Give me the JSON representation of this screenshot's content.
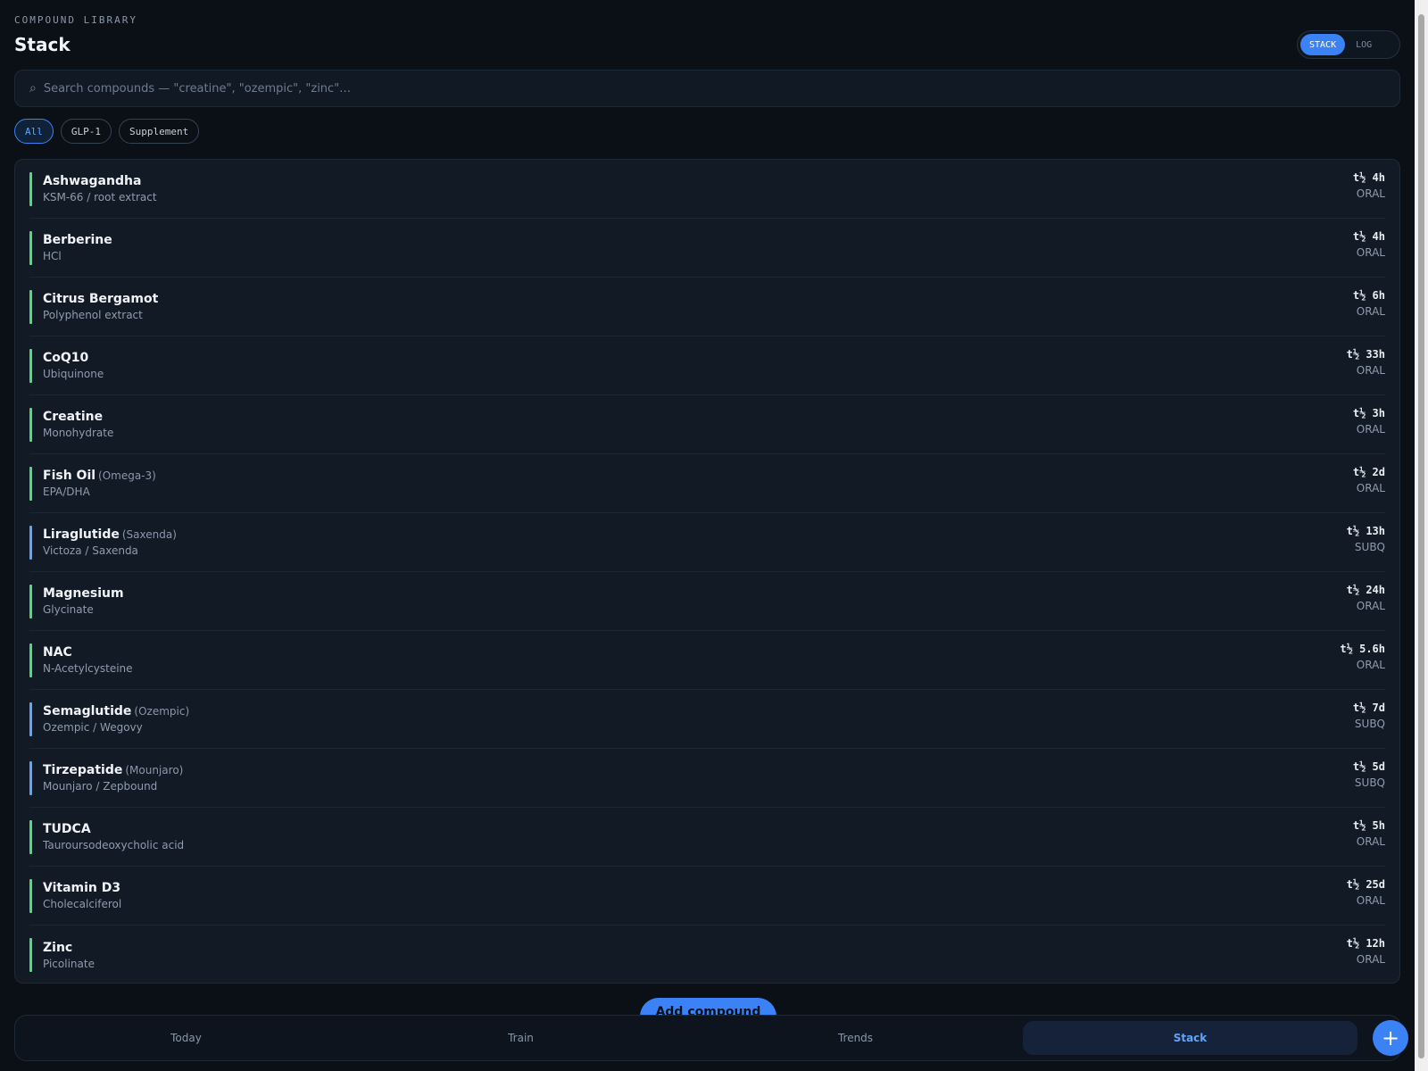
{
  "header": {
    "eyebrow": "COMPOUND LIBRARY",
    "title": "Stack"
  },
  "view_toggle": {
    "options": [
      "STACK",
      "LOG"
    ],
    "selected": "STACK"
  },
  "search": {
    "placeholder": "Search compounds — \"creatine\", \"ozempic\", \"zinc\"…",
    "value": ""
  },
  "filters": {
    "chips": [
      "All",
      "GLP-1",
      "Supplement"
    ],
    "selected": "All"
  },
  "colors": {
    "supplement": "#4ade80",
    "glp1": "#60a5fa",
    "accent": "#3b82f6"
  },
  "compounds": [
    {
      "name": "Ashwagandha",
      "alias": "",
      "sub": "KSM-66 / root extract",
      "half_life": "t½ 4h",
      "route": "ORAL",
      "category": "supplement"
    },
    {
      "name": "Berberine",
      "alias": "",
      "sub": "HCl",
      "half_life": "t½ 4h",
      "route": "ORAL",
      "category": "supplement"
    },
    {
      "name": "Citrus Bergamot",
      "alias": "",
      "sub": "Polyphenol extract",
      "half_life": "t½ 6h",
      "route": "ORAL",
      "category": "supplement"
    },
    {
      "name": "CoQ10",
      "alias": "",
      "sub": "Ubiquinone",
      "half_life": "t½ 33h",
      "route": "ORAL",
      "category": "supplement"
    },
    {
      "name": "Creatine",
      "alias": "",
      "sub": "Monohydrate",
      "half_life": "t½ 3h",
      "route": "ORAL",
      "category": "supplement"
    },
    {
      "name": "Fish Oil",
      "alias": "(Omega-3)",
      "sub": "EPA/DHA",
      "half_life": "t½ 2d",
      "route": "ORAL",
      "category": "supplement"
    },
    {
      "name": "Liraglutide",
      "alias": "(Saxenda)",
      "sub": "Victoza / Saxenda",
      "half_life": "t½ 13h",
      "route": "SUBQ",
      "category": "glp1"
    },
    {
      "name": "Magnesium",
      "alias": "",
      "sub": "Glycinate",
      "half_life": "t½ 24h",
      "route": "ORAL",
      "category": "supplement"
    },
    {
      "name": "NAC",
      "alias": "",
      "sub": "N-Acetylcysteine",
      "half_life": "t½ 5.6h",
      "route": "ORAL",
      "category": "supplement"
    },
    {
      "name": "Semaglutide",
      "alias": "(Ozempic)",
      "sub": "Ozempic / Wegovy",
      "half_life": "t½ 7d",
      "route": "SUBQ",
      "category": "glp1"
    },
    {
      "name": "Tirzepatide",
      "alias": "(Mounjaro)",
      "sub": "Mounjaro / Zepbound",
      "half_life": "t½ 5d",
      "route": "SUBQ",
      "category": "glp1"
    },
    {
      "name": "TUDCA",
      "alias": "",
      "sub": "Tauroursodeoxycholic acid",
      "half_life": "t½ 5h",
      "route": "ORAL",
      "category": "supplement"
    },
    {
      "name": "Vitamin D3",
      "alias": "",
      "sub": "Cholecalciferol",
      "half_life": "t½ 25d",
      "route": "ORAL",
      "category": "supplement"
    },
    {
      "name": "Zinc",
      "alias": "",
      "sub": "Picolinate",
      "half_life": "t½ 12h",
      "route": "ORAL",
      "category": "supplement"
    }
  ],
  "add_button": {
    "label": "Add compound",
    "icon": "plus-icon"
  },
  "bottom_nav": {
    "items": [
      "Today",
      "Train",
      "Trends",
      "Stack"
    ],
    "selected": "Stack"
  }
}
